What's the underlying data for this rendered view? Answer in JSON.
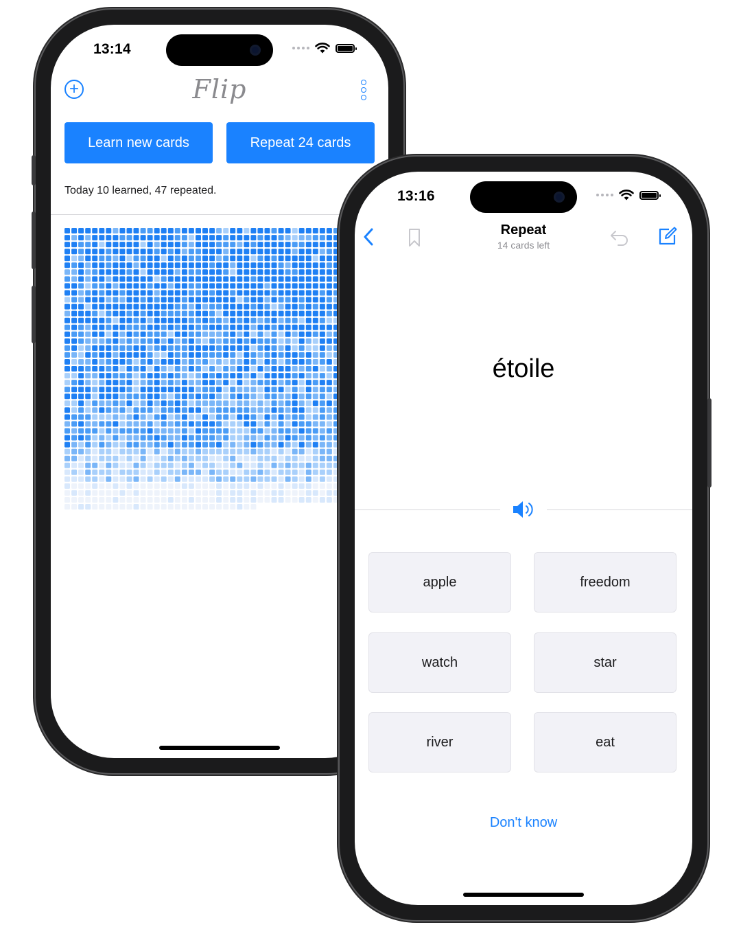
{
  "colors": {
    "accent": "#1a82ff",
    "grid_shades": [
      "#1f80f4",
      "#4a9cf6",
      "#7ab6f8",
      "#a9d0fb",
      "#d8e8fc",
      "#eef3fb"
    ]
  },
  "phone1": {
    "status": {
      "time": "13:14"
    },
    "header": {
      "logo": "Flip",
      "add_icon": "plus-circle-icon",
      "more_icon": "vertical-dots-icon"
    },
    "buttons": {
      "learn": "Learn new cards",
      "repeat": "Repeat 24 cards"
    },
    "today_summary": "Today 10 learned, 47 repeated."
  },
  "phone2": {
    "status": {
      "time": "13:16"
    },
    "nav": {
      "back_icon": "chevron-left-icon",
      "bookmark_icon": "bookmark-icon",
      "title": "Repeat",
      "subtitle": "14 cards left",
      "undo_icon": "undo-arrow-icon",
      "edit_icon": "compose-icon"
    },
    "card": {
      "word": "étoile",
      "audio_icon": "speaker-icon"
    },
    "answers": [
      "apple",
      "freedom",
      "watch",
      "star",
      "river",
      "eat"
    ],
    "dont_know": "Don't know"
  }
}
